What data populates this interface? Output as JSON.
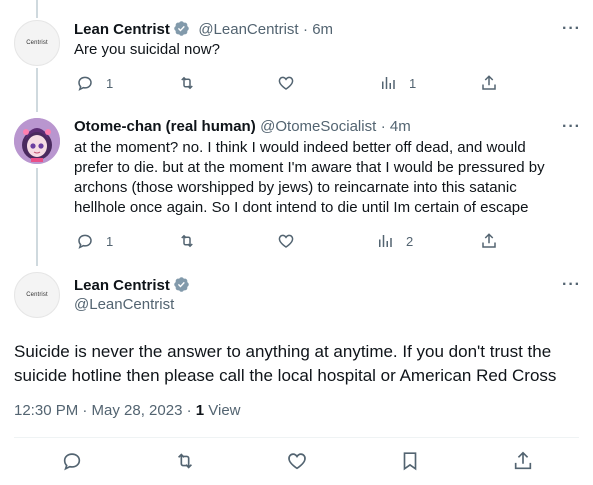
{
  "tweet1": {
    "avatar_text": "Centrist",
    "name": "Lean Centrist",
    "handle": "@LeanCentrist",
    "time": "· 6m",
    "text": "Are you suicidal now?",
    "replies": "1",
    "views": "1"
  },
  "tweet2": {
    "name": "Otome-chan (real human)",
    "handle": "@OtomeSocialist",
    "time": "· 4m",
    "lines": [
      "at the moment? no. I think I would indeed better off dead, and would",
      "prefer to die. but at the moment I'm aware that I would be pressured by",
      "archons (those worshipped by jews) to reincarnate into this satanic",
      "hellhole once again. So I dont intend to die until Im certain of escape"
    ],
    "replies": "1",
    "views": "2"
  },
  "main": {
    "avatar_text": "Centrist",
    "name": "Lean Centrist",
    "handle": "@LeanCentrist",
    "lines": [
      "Suicide is never the answer to anything at anytime. If you don't trust the",
      "suicide hotline then please call the local hospital or American Red Cross"
    ],
    "timestamp": "12:30 PM · May 28, 2023 · ",
    "views_count": "1",
    "views_label": " View"
  },
  "colors": {
    "verified": "#829aab",
    "muted": "#536471",
    "text": "#0f1419",
    "divider": "#eff3f4"
  },
  "icons": [
    "reply-icon",
    "retweet-icon",
    "like-icon",
    "views-icon",
    "share-icon",
    "bookmark-icon",
    "more-icon",
    "verified-badge-icon"
  ]
}
